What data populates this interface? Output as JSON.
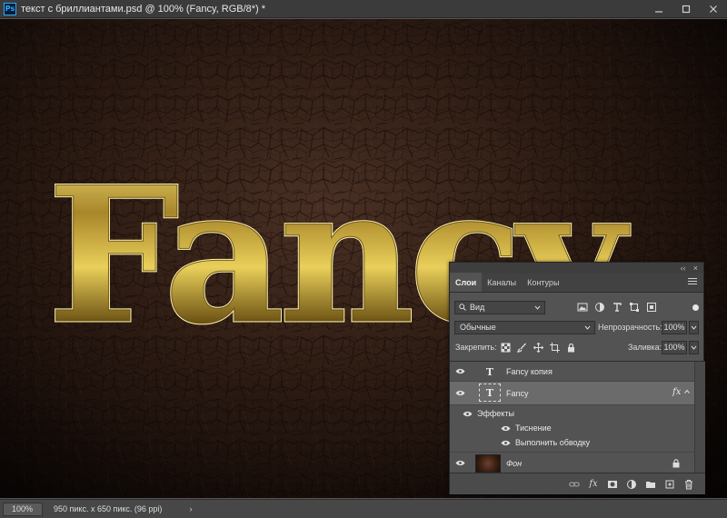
{
  "window": {
    "app_badge": "Ps",
    "title": "текст с бриллиантами.psd @ 100% (Fancy, RGB/8*) *"
  },
  "canvas": {
    "artwork_text": "Fancy"
  },
  "statusbar": {
    "zoom": "100%",
    "doc_info": "950 пикс. x 650 пикс. (96 ppi)",
    "arrow": "›"
  },
  "layers_panel": {
    "collapse_glyph": "‹‹",
    "close_glyph": "×",
    "tabs": [
      {
        "label": "Слои",
        "active": true
      },
      {
        "label": "Каналы",
        "active": false
      },
      {
        "label": "Контуры",
        "active": false
      }
    ],
    "filter": {
      "value": "Вид",
      "icons": [
        "image-filter-icon",
        "adjustment-filter-icon",
        "type-filter-icon",
        "shape-filter-icon",
        "smart-object-filter-icon"
      ]
    },
    "blend_mode": "Обычные",
    "opacity_label": "Непрозрачность:",
    "opacity_value": "100%",
    "lock_label": "Закрепить:",
    "fill_label": "Заливка:",
    "fill_value": "100%",
    "layers": [
      {
        "name": "Fancy копия",
        "type": "text",
        "visible": true,
        "selected": false
      },
      {
        "name": "Fancy",
        "type": "text",
        "visible": true,
        "selected": true,
        "fx": "fx"
      },
      {
        "name": "Фон",
        "type": "image",
        "visible": true,
        "selected": false,
        "locked": true
      }
    ],
    "effects_label": "Эффекты",
    "effects": [
      "Тиснение",
      "Выполнить обводку"
    ],
    "footer_fx": "fx"
  },
  "colors": {
    "accent": "#31a8ff",
    "gold": "#c9a83a",
    "leather": "#3a2419"
  }
}
